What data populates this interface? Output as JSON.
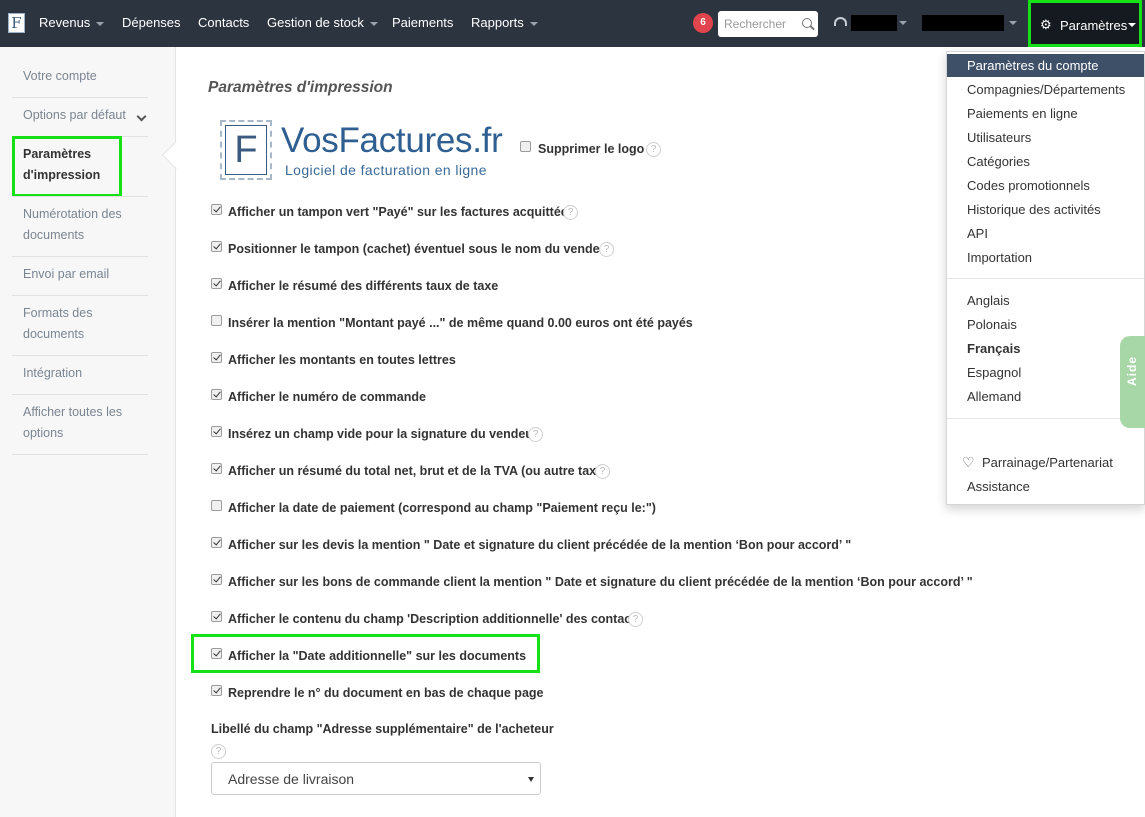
{
  "nav": {
    "items": [
      "Revenus",
      "Dépenses",
      "Contacts",
      "Gestion de stock",
      "Paiements",
      "Rapports"
    ],
    "notification_count": "6",
    "search_placeholder": "Rechercher",
    "settings_label": "Paramètres",
    "logo_letter": "F"
  },
  "sidebar": {
    "items": [
      "Votre compte",
      "Options par défaut",
      "Paramètres d'impression",
      "Numérotation des documents",
      "Envoi par email",
      "Formats des documents",
      "Intégration",
      "Afficher toutes les options"
    ],
    "active": "Paramètres d'impression"
  },
  "main": {
    "title": "Paramètres d'impression",
    "brand": {
      "letter": "F",
      "name": "VosFactures.fr",
      "tagline": "Logiciel de facturation en ligne"
    },
    "remove_logo_label": "Supprimer le logo",
    "help_glyph": "?",
    "options": [
      {
        "label": "Afficher un tampon vert \"Payé\" sur les factures acquittées",
        "checked": true
      },
      {
        "label": "Positionner le tampon (cachet) éventuel sous le nom du vendeur",
        "checked": true
      },
      {
        "label": "Afficher le résumé des différents taux de taxe",
        "checked": true
      },
      {
        "label": "Insérer la mention \"Montant payé ...\" de même quand 0.00 euros ont été payés",
        "checked": false
      },
      {
        "label": "Afficher les montants en toutes lettres",
        "checked": true
      },
      {
        "label": "Afficher le numéro de commande",
        "checked": true
      },
      {
        "label": "Insérez un champ vide pour la signature du vendeur",
        "checked": true
      },
      {
        "label": "Afficher un résumé du total net, brut et de la TVA (ou autre taxe)",
        "checked": true
      },
      {
        "label": "Afficher la date de paiement (correspond au champ \"Paiement reçu le:\")",
        "checked": false
      },
      {
        "label": "Afficher sur les devis la mention \" Date et signature du client précédée de la mention ‘Bon pour accord’ \"",
        "checked": true
      },
      {
        "label": "Afficher sur les bons de commande client la mention \" Date et signature du client précédée de la mention ‘Bon pour accord’ \"",
        "checked": true
      },
      {
        "label": "Afficher le contenu du champ 'Description additionnelle' des contacts",
        "checked": true
      },
      {
        "label": "Afficher la \"Date additionnelle\" sur les documents",
        "checked": true
      },
      {
        "label": "Reprendre le n° du document en bas de chaque page",
        "checked": true
      }
    ],
    "address_field_label": "Libellé du champ \"Adresse supplémentaire\" de l'acheteur",
    "address_field_value": "Adresse de livraison"
  },
  "dropdown": {
    "account_items": [
      "Paramètres du compte",
      "Compagnies/Départements",
      "Paiements en ligne",
      "Utilisateurs",
      "Catégories",
      "Codes promotionnels",
      "Historique des activités",
      "API",
      "Importation"
    ],
    "languages": [
      "Anglais",
      "Polonais",
      "Français",
      "Espagnol",
      "Allemand"
    ],
    "active_language": "Français",
    "partner_label": "Parrainage/Partenariat",
    "support_label": "Assistance"
  },
  "help_tab": "Aide",
  "colors": {
    "navbar": "#2c3440",
    "highlight": "#16e016",
    "dropdown_active": "#3e5068",
    "brand": "#2f5f90"
  }
}
